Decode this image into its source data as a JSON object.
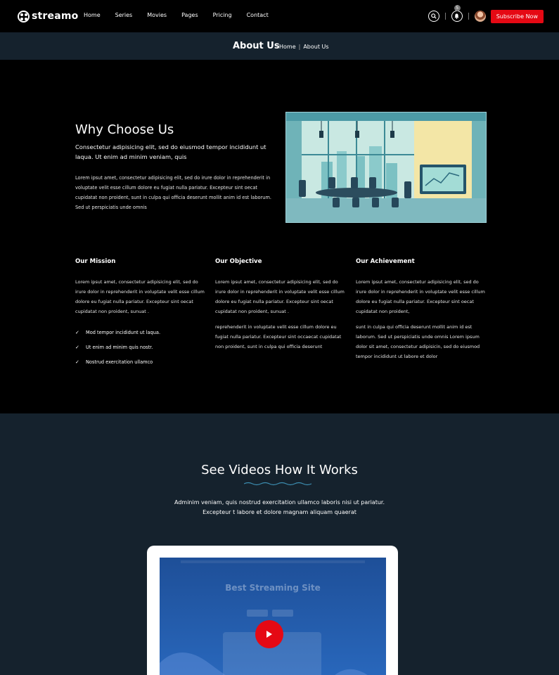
{
  "header": {
    "logo": "streamo",
    "nav": [
      "Home",
      "Series",
      "Movies",
      "Pages",
      "Pricing",
      "Contact"
    ],
    "notification_count": "5",
    "subscribe_label": "Subscribe Now",
    "icons": [
      "search-icon",
      "bell-icon"
    ]
  },
  "banner": {
    "title": "About Us",
    "breadcrumb": [
      "Home",
      "About Us"
    ]
  },
  "why": {
    "title": "Why Choose Us",
    "subtitle": "Consectetur adipisicing elit, sed do eiusmod tempor incididunt ut laqua. Ut enim ad minim veniam, quis",
    "body": "Lorem ipsut amet, consectetur adipisicing elit, sed do irure dolor in reprehenderit in voluptate velit esse cillum dolore eu fugiat nulla pariatur. Excepteur sint oecat cupidatat non proident, sunt in culpa qui officia deserunt mollit anim id est laborum. Sed ut perspiciatis unde omnis"
  },
  "columns": [
    {
      "title": "Our Mission",
      "p1": "Lorem ipsut amet, consectetur adipisicing elit, sed do irure dolor in reprehenderit in voluptate velit esse cillum dolore eu fugiat nulla pariatur. Excepteur sint oecat cupidatat non proident, sunuat .",
      "checks": [
        "Mod tempor incididunt ut laqua.",
        "Ut enim ad minim quis nostr.",
        "Nostrud exercitation ullamco"
      ]
    },
    {
      "title": "Our Objective",
      "p1": "Lorem ipsut amet, consectetur adipisicing elit, sed do irure dolor in reprehenderit in voluptate velit esse cillum dolore eu fugiat nulla pariatur. Excepteur sint oecat cupidatat non proident, sunuat .",
      "p2": "reprehenderit in voluptate velit esse cillum dolore eu fugiat nulla pariatur. Excepteur sint occaecat cupidatat non proident, sunt in culpa qui officia deserunt"
    },
    {
      "title": "Our Achievement",
      "p1": "Lorem ipsut amet, consectetur adipisicing elit, sed do irure dolor in reprehenderit in voluptate velit esse cillum dolore eu fugiat nulla pariatur. Excepteur sint oecat cupidatat non proident,",
      "p2": "sunt in culpa qui officia deserunt mollit anim id est laborum. Sed ut perspiciatis unde omnis Lorem ipsum dolor sit amet, consectetur adipisicin, sed do eiusmod tempor incididunt ut labore et dolor"
    }
  ],
  "video": {
    "title": "See Videos How It Works",
    "description": "Adminim veniam, quis nostrud exercitation ullamco laboris nisi ut pariatur. Excepteur t labore et dolore magnam aliquam quaerat",
    "screen_title": "Best Streaming Site"
  },
  "colors": {
    "accent": "#e50914",
    "banner_bg": "#15222d",
    "page_bg": "#000000"
  }
}
